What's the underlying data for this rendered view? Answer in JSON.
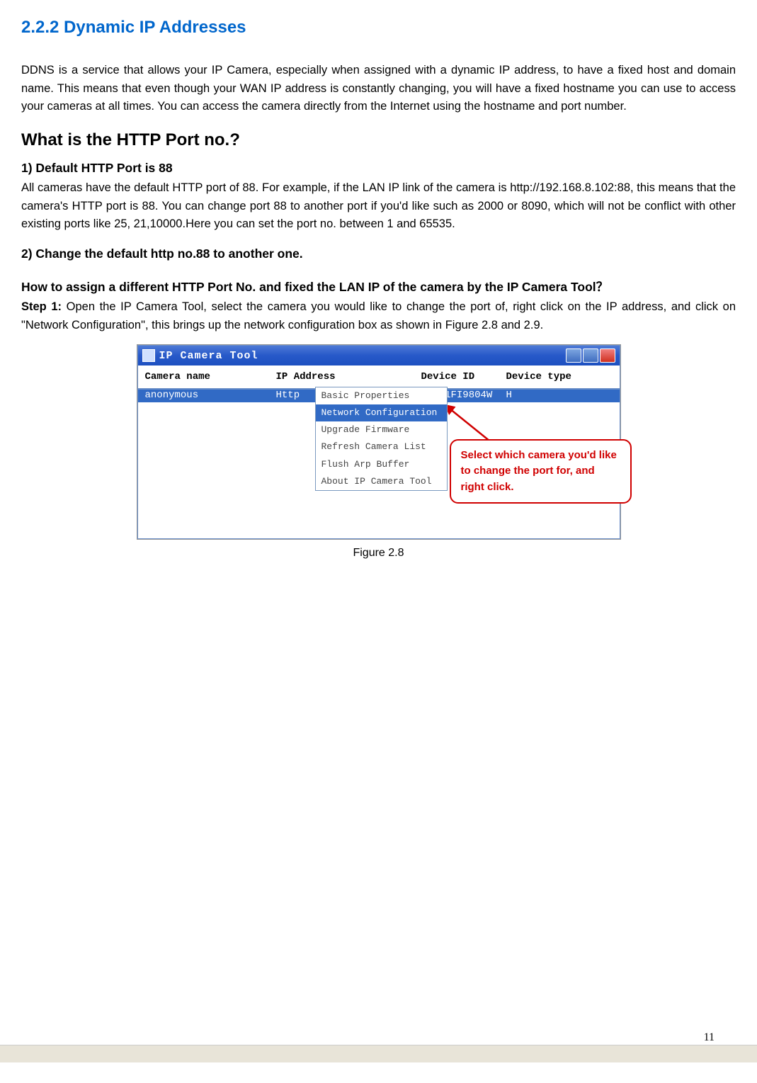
{
  "section_title": "2.2.2 Dynamic IP Addresses",
  "intro_para": "DDNS is a service that allows your IP Camera, especially when assigned with a dynamic IP address, to have a fixed host and domain name. This means that even though your WAN IP address is constantly changing, you will have a fixed hostname you can use to access your cameras at all times. You can access the camera directly from the Internet using the hostname and port number.",
  "h2_1": "What is the HTTP Port no.?",
  "h3_1": "1) Default HTTP Port is 88",
  "para_1": "All cameras have the default HTTP port of 88. For example, if the LAN IP link of the camera is http://192.168.8.102:88, this means that the camera's HTTP port is 88. You can change port 88 to another port if you'd like such as 2000 or 8090, which will not be conflict with other existing ports like 25, 21,10000.Here you can set the port no. between 1 and 65535.",
  "h3_2": "2)  Change the default http no.88 to another one.",
  "h3_3": "How to assign a different HTTP Port No. and fixed the LAN IP of the camera by the IP Camera Tool？",
  "step1_label": "Step 1:",
  "step1_text": " Open the IP Camera Tool, select the camera you would like to change the port of, right click on the IP address, and click on \"Network Configuration\", this brings up the network configuration box as shown in Figure 2.8 and 2.9.",
  "window": {
    "title": "IP Camera Tool",
    "headers": {
      "name": "Camera name",
      "ip": "IP Address",
      "did": "Device ID",
      "type": "Device type"
    },
    "row": {
      "name": "anonymous",
      "ip": "Http",
      "did": "00841FI9804W",
      "type": "H"
    },
    "menu": [
      "Basic Properties",
      "Network Configuration",
      "Upgrade Firmware",
      "Refresh Camera List",
      "Flush Arp Buffer",
      "About IP Camera Tool"
    ]
  },
  "callout_text": "Select which camera you'd like to change the port for, and right click.",
  "figure_caption": "Figure 2.8",
  "page_no": "11"
}
